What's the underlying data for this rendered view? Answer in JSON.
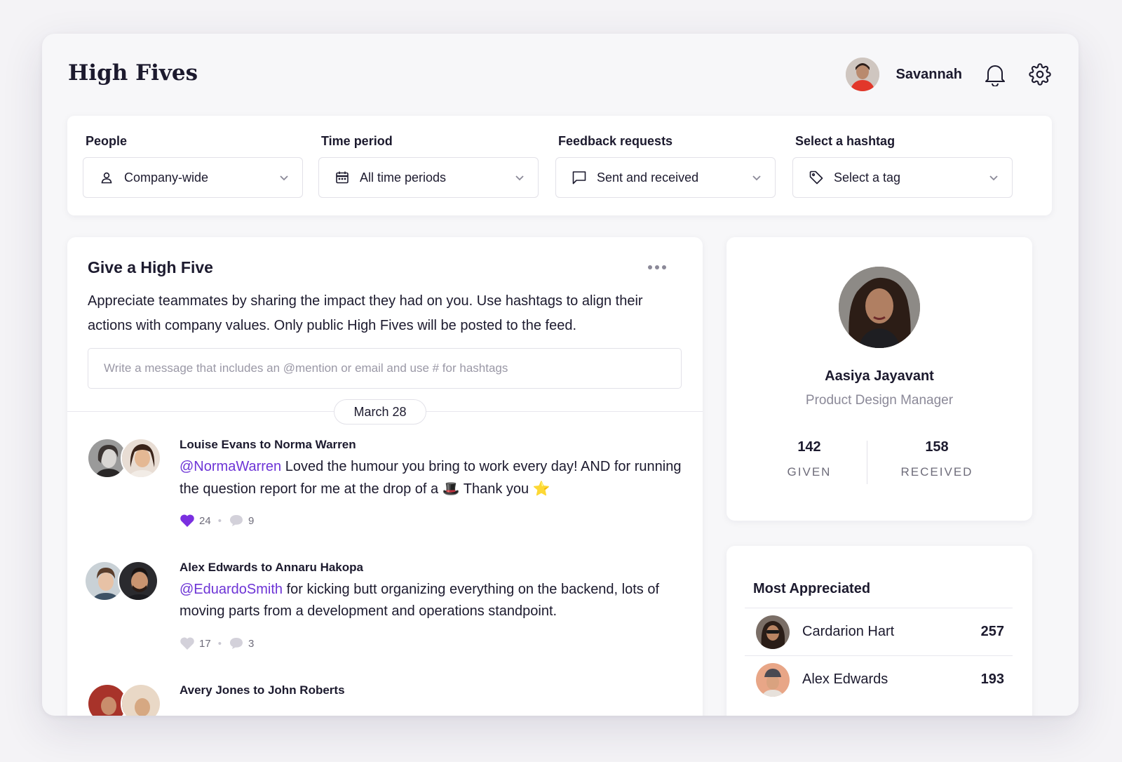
{
  "app": {
    "title": "High Fives"
  },
  "header": {
    "user_name": "Savannah"
  },
  "filters": [
    {
      "label": "People",
      "value": "Company-wide",
      "icon": "person-icon"
    },
    {
      "label": "Time period",
      "value": "All time periods",
      "icon": "calendar-icon"
    },
    {
      "label": "Feedback requests",
      "value": "Sent and received",
      "icon": "message-icon"
    },
    {
      "label": "Select a hashtag",
      "value": "Select a tag",
      "icon": "tag-icon"
    }
  ],
  "give": {
    "title": "Give a High Five",
    "description": "Appreciate teammates by sharing the impact they had on you. Use hashtags to align their actions with company values. Only public High Fives will be posted to the feed.",
    "placeholder": "Write a message that includes an @mention or email and use # for hashtags"
  },
  "feed": {
    "date": "March 28",
    "posts": [
      {
        "names": "Louise Evans to Norma Warren",
        "mention": "@NormaWarren",
        "text_before_hat": " Loved the humour you bring to work every day! AND for running the question report for me at the drop of a ",
        "hat": "🎩",
        "text_after_hat": " Thank you ",
        "star": "⭐",
        "likes": "24",
        "comments": "9",
        "liked": true
      },
      {
        "names": "Alex Edwards to Annaru Hakopa",
        "mention": "@EduardoSmith",
        "text": " for kicking butt organizing everything on the backend, lots of moving parts from a development and operations standpoint.",
        "likes": "17",
        "comments": "3",
        "liked": false
      },
      {
        "names": "Avery Jones to John Roberts"
      }
    ]
  },
  "profile": {
    "name": "Aasiya Jayavant",
    "role": "Product Design Manager",
    "given": "142",
    "given_label": "GIVEN",
    "received": "158",
    "received_label": "RECEIVED"
  },
  "most_appreciated": {
    "title": "Most Appreciated",
    "people": [
      {
        "name": "Cardarion Hart",
        "count": "257"
      },
      {
        "name": "Alex Edwards",
        "count": "193"
      }
    ]
  },
  "colors": {
    "accent": "#6d34d6",
    "heart_active": "#7a2fe0",
    "muted": "#c9c7d2"
  }
}
